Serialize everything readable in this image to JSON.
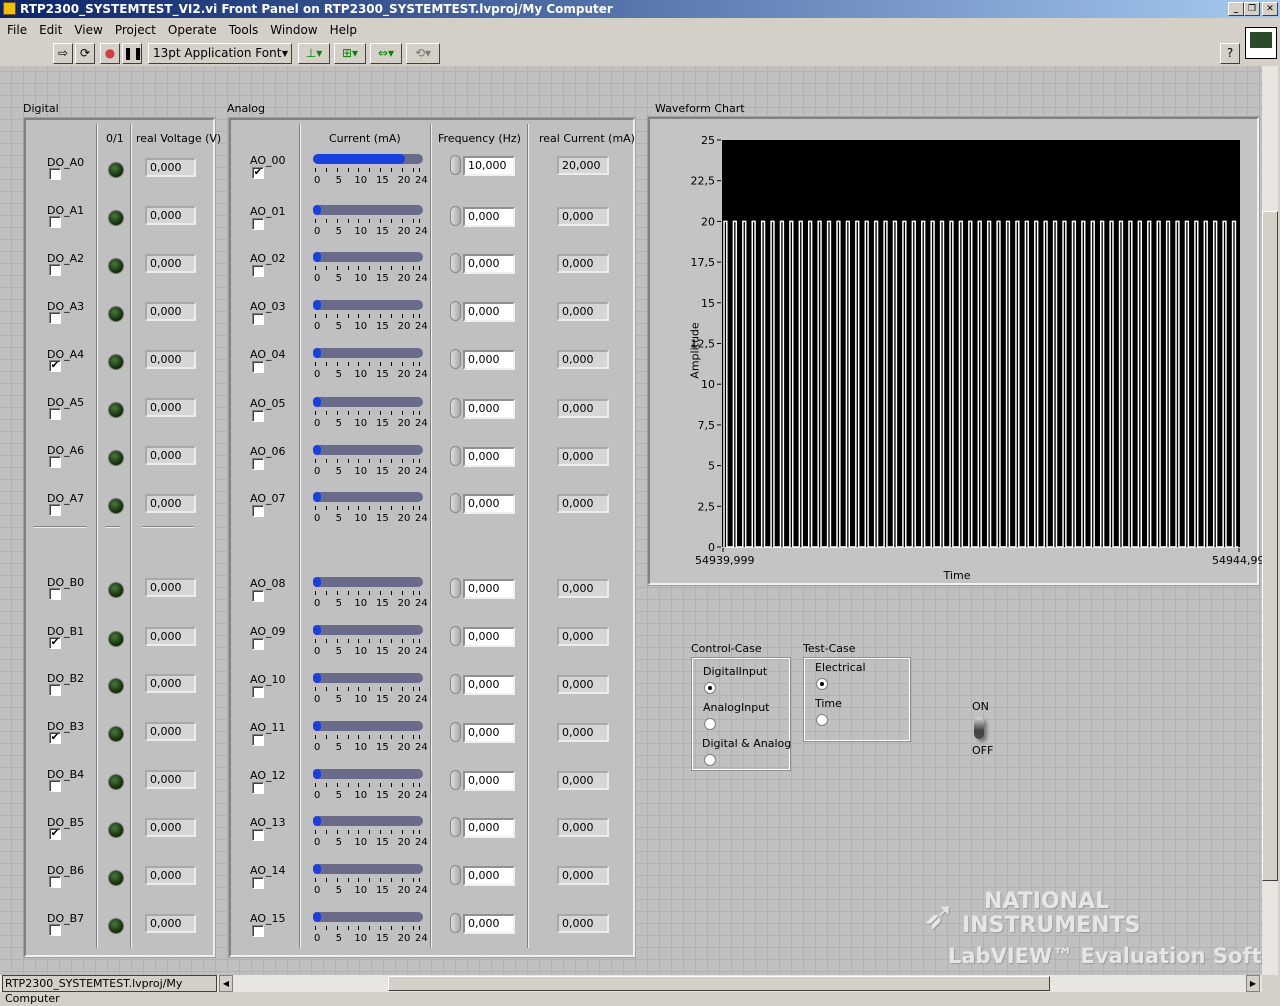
{
  "window": {
    "title": "RTP2300_SYSTEMTEST_VI2.vi Front Panel on RTP2300_SYSTEMTEST.lvproj/My Computer",
    "minimize": "_",
    "restore": "❐",
    "close": "✕"
  },
  "menu": [
    "File",
    "Edit",
    "View",
    "Project",
    "Operate",
    "Tools",
    "Window",
    "Help"
  ],
  "toolbar": {
    "font": "13pt Application Font",
    "help": "?"
  },
  "digital": {
    "title": "Digital",
    "col_state": "0/1",
    "col_voltage": "real Voltage (V)",
    "rows": [
      {
        "name": "DO_A0",
        "checked": false,
        "voltage": "0,000"
      },
      {
        "name": "DO_A1",
        "checked": false,
        "voltage": "0,000"
      },
      {
        "name": "DO_A2",
        "checked": false,
        "voltage": "0,000"
      },
      {
        "name": "DO_A3",
        "checked": false,
        "voltage": "0,000"
      },
      {
        "name": "DO_A4",
        "checked": true,
        "voltage": "0,000"
      },
      {
        "name": "DO_A5",
        "checked": false,
        "voltage": "0,000"
      },
      {
        "name": "DO_A6",
        "checked": false,
        "voltage": "0,000"
      },
      {
        "name": "DO_A7",
        "checked": false,
        "voltage": "0,000"
      },
      {
        "name": "DO_B0",
        "checked": false,
        "voltage": "0,000"
      },
      {
        "name": "DO_B1",
        "checked": true,
        "voltage": "0,000"
      },
      {
        "name": "DO_B2",
        "checked": false,
        "voltage": "0,000"
      },
      {
        "name": "DO_B3",
        "checked": true,
        "voltage": "0,000"
      },
      {
        "name": "DO_B4",
        "checked": false,
        "voltage": "0,000"
      },
      {
        "name": "DO_B5",
        "checked": true,
        "voltage": "0,000"
      },
      {
        "name": "DO_B6",
        "checked": false,
        "voltage": "0,000"
      },
      {
        "name": "DO_B7",
        "checked": false,
        "voltage": "0,000"
      }
    ]
  },
  "analog": {
    "title": "Analog",
    "col_current": "Current (mA)",
    "col_freq": "Frequency (Hz)",
    "col_real": "real Current (mA)",
    "scale": [
      "0",
      "5",
      "10",
      "15",
      "20",
      "24"
    ],
    "scale_max": 24,
    "rows": [
      {
        "name": "AO_00",
        "checked": true,
        "current": 20,
        "freq": "10,000",
        "real": "20,000"
      },
      {
        "name": "AO_01",
        "checked": false,
        "current": 0,
        "freq": "0,000",
        "real": "0,000"
      },
      {
        "name": "AO_02",
        "checked": false,
        "current": 0,
        "freq": "0,000",
        "real": "0,000"
      },
      {
        "name": "AO_03",
        "checked": false,
        "current": 0,
        "freq": "0,000",
        "real": "0,000"
      },
      {
        "name": "AO_04",
        "checked": false,
        "current": 0,
        "freq": "0,000",
        "real": "0,000"
      },
      {
        "name": "AO_05",
        "checked": false,
        "current": 0,
        "freq": "0,000",
        "real": "0,000"
      },
      {
        "name": "AO_06",
        "checked": false,
        "current": 0,
        "freq": "0,000",
        "real": "0,000"
      },
      {
        "name": "AO_07",
        "checked": false,
        "current": 0,
        "freq": "0,000",
        "real": "0,000"
      },
      {
        "name": "AO_08",
        "checked": false,
        "current": 0,
        "freq": "0,000",
        "real": "0,000"
      },
      {
        "name": "AO_09",
        "checked": false,
        "current": 0,
        "freq": "0,000",
        "real": "0,000"
      },
      {
        "name": "AO_10",
        "checked": false,
        "current": 0,
        "freq": "0,000",
        "real": "0,000"
      },
      {
        "name": "AO_11",
        "checked": false,
        "current": 0,
        "freq": "0,000",
        "real": "0,000"
      },
      {
        "name": "AO_12",
        "checked": false,
        "current": 0,
        "freq": "0,000",
        "real": "0,000"
      },
      {
        "name": "AO_13",
        "checked": false,
        "current": 0,
        "freq": "0,000",
        "real": "0,000"
      },
      {
        "name": "AO_14",
        "checked": false,
        "current": 0,
        "freq": "0,000",
        "real": "0,000"
      },
      {
        "name": "AO_15",
        "checked": false,
        "current": 0,
        "freq": "0,000",
        "real": "0,000"
      }
    ]
  },
  "chart_data": {
    "type": "line",
    "title": "Waveform Chart",
    "xlabel": "Time",
    "ylabel": "Amplitude",
    "ylim": [
      0,
      25
    ],
    "yticks": [
      "0",
      "2,5",
      "5",
      "7,5",
      "10",
      "12,5",
      "15",
      "17,5",
      "20",
      "22,5",
      "25"
    ],
    "xlim_labels": [
      "54939,999",
      "54944,99"
    ],
    "xlim": [
      54939.999,
      54944.999
    ],
    "series": [
      {
        "name": "AO_00",
        "waveform": "square",
        "low": 0,
        "high": 20,
        "frequency_hz": 10,
        "color": "#ffffff"
      }
    ]
  },
  "control_case": {
    "label": "Control-Case",
    "options": [
      "DigitalInput",
      "AnalogInput",
      "Digital & Analog"
    ],
    "selected": 0
  },
  "test_case": {
    "label": "Test-Case",
    "options": [
      "Electrical",
      "Time"
    ],
    "selected": 0
  },
  "switch": {
    "on": "ON",
    "off": "OFF"
  },
  "watermark": {
    "line1": "NATIONAL",
    "line2": "INSTRUMENTS",
    "line3": "LabVIEW™ Evaluation Software"
  },
  "status": {
    "path": "RTP2300_SYSTEMTEST.lvproj/My Computer"
  }
}
